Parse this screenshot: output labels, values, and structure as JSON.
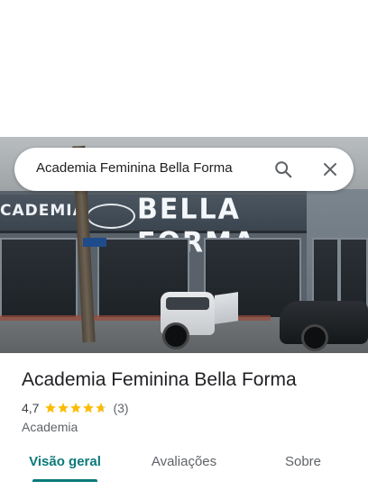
{
  "search": {
    "query": "Academia Feminina Bella Forma",
    "search_icon": "search-icon",
    "close_icon": "close-icon"
  },
  "photo": {
    "sign_left": "CADEMIA",
    "sign_right": "BELLA FORMA"
  },
  "place": {
    "title": "Academia Feminina Bella Forma",
    "rating": "4,7",
    "stars": 4.7,
    "review_count": "(3)",
    "category": "Academia"
  },
  "tabs": [
    {
      "label": "Visão geral",
      "active": true
    },
    {
      "label": "Avaliações",
      "active": false
    },
    {
      "label": "Sobre",
      "active": false
    }
  ],
  "colors": {
    "accent": "#0b7a7a",
    "star": "#fbbc04",
    "star_empty": "#dadce0"
  }
}
